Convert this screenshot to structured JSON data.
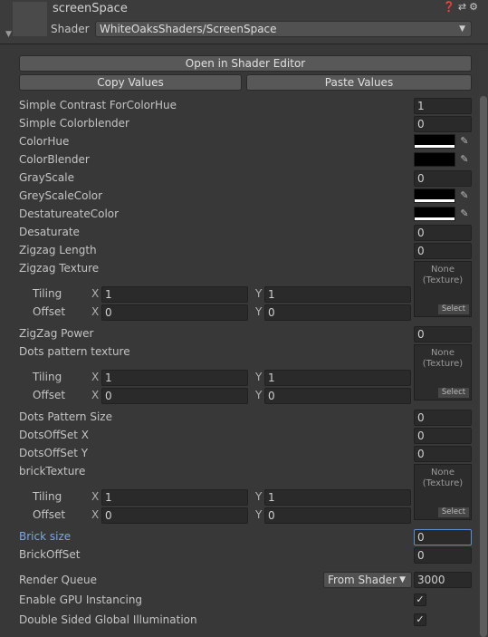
{
  "header": {
    "title": "screenSpace",
    "shader_label": "Shader",
    "shader_value": "WhiteOaksShaders/ScreenSpace"
  },
  "buttons": {
    "open_editor": "Open in Shader Editor",
    "copy": "Copy Values",
    "paste": "Paste Values"
  },
  "props": {
    "simple_contrast": {
      "label": "Simple Contrast ForColorHue",
      "value": "1"
    },
    "simple_colorblender": {
      "label": "Simple Colorblender",
      "value": "0"
    },
    "colorhue": {
      "label": "ColorHue",
      "color": "#000000"
    },
    "colorblender": {
      "label": "ColorBlender",
      "color": "#000000"
    },
    "grayscale": {
      "label": "GrayScale",
      "value": "0"
    },
    "greyscalecolor": {
      "label": "GreyScaleColor",
      "color": "#000000"
    },
    "destaturate": {
      "label": "DestatureateColor",
      "color": "#000000"
    },
    "desaturate": {
      "label": "Desaturate",
      "value": "0"
    },
    "zigzag_length": {
      "label": "Zigzag Length",
      "value": "0"
    },
    "zigzag_texture": {
      "label": "Zigzag Texture",
      "tex": "None\n(Texture)",
      "select": "Select",
      "tiling": {
        "label": "Tiling",
        "x": "1",
        "y": "1"
      },
      "offset": {
        "label": "Offset",
        "x": "0",
        "y": "0"
      }
    },
    "zigzag_power": {
      "label": "ZigZag Power",
      "value": "0"
    },
    "dots_texture": {
      "label": "Dots pattern texture",
      "tex": "None\n(Texture)",
      "select": "Select",
      "tiling": {
        "label": "Tiling",
        "x": "1",
        "y": "1"
      },
      "offset": {
        "label": "Offset",
        "x": "0",
        "y": "0"
      }
    },
    "dots_size": {
      "label": "Dots Pattern Size",
      "value": "0"
    },
    "dots_offx": {
      "label": "DotsOffSet X",
      "value": "0"
    },
    "dots_offy": {
      "label": "DotsOffSet Y",
      "value": "0"
    },
    "brick_texture": {
      "label": "brickTexture",
      "tex": "None\n(Texture)",
      "select": "Select",
      "tiling": {
        "label": "Tiling",
        "x": "1",
        "y": "1"
      },
      "offset": {
        "label": "Offset",
        "x": "0",
        "y": "0"
      }
    },
    "brick_size": {
      "label": "Brick size",
      "value": "0"
    },
    "brick_offset": {
      "label": "BrickOffSet",
      "value": "0"
    }
  },
  "render": {
    "queue_label": "Render Queue",
    "queue_mode": "From Shader",
    "queue_value": "3000",
    "gpu_label": "Enable GPU Instancing",
    "gi_label": "Double Sided Global Illumination"
  },
  "axes": {
    "x": "X",
    "y": "Y"
  },
  "colors": {
    "accent": "#7ba7e6",
    "background": "#383838"
  }
}
